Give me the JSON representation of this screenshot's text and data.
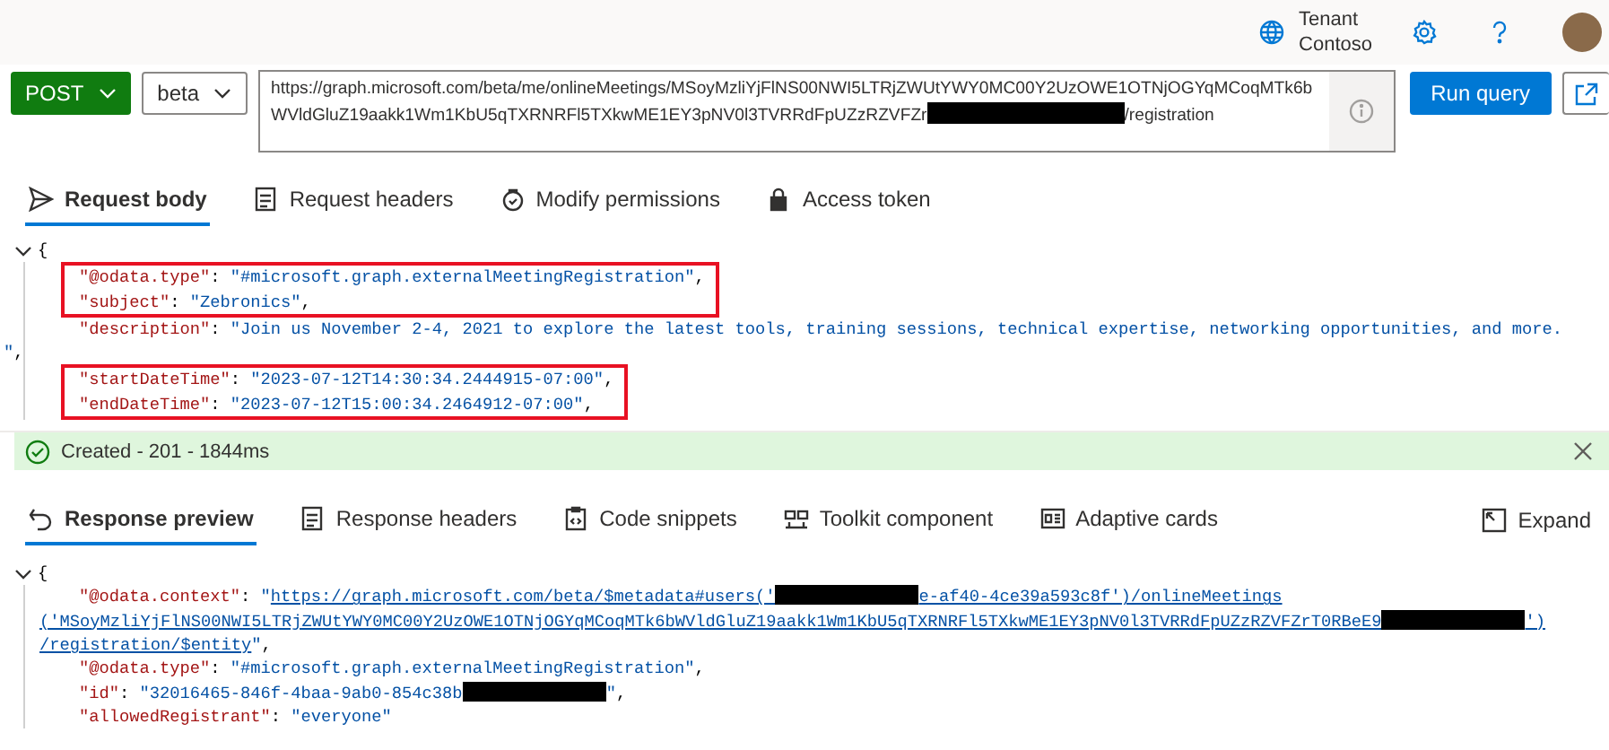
{
  "header": {
    "tenant_label": "Tenant",
    "tenant_name": "Contoso"
  },
  "query": {
    "method": "POST",
    "version": "beta",
    "url_parts": [
      {
        "kind": "text",
        "text": "https://graph.microsoft.com/beta/me/onlineMeetings/MSoyMzliYjFlNS00NWI5LTRjZWUtYWY0MC00Y2UzOWE1OTNjOGYqMCoqMTk6bWVldGluZ19aakk1Wm1KbU5qTXRNRFl5TXkwME1EY3pNV0l3TVRRdFpUZzRZVFZr"
      },
      {
        "kind": "redacted"
      },
      {
        "kind": "text",
        "text": "/registration"
      }
    ],
    "run_label": "Run query"
  },
  "request_tabs": [
    {
      "label": "Request body",
      "selected": true
    },
    {
      "label": "Request headers",
      "selected": false
    },
    {
      "label": "Modify permissions",
      "selected": false
    },
    {
      "label": "Access token",
      "selected": false
    }
  ],
  "request_body": {
    "expanded": true,
    "open": "{",
    "lines": [
      {
        "kind": "member",
        "highlighted": true,
        "parts": [
          {
            "kind": "key",
            "text": "\"@odata.type\""
          },
          {
            "kind": "punct",
            "text": ": "
          },
          {
            "kind": "string",
            "text": "\"#microsoft.graph.externalMeetingRegistration\""
          },
          {
            "kind": "punct",
            "text": ","
          }
        ]
      },
      {
        "kind": "member",
        "highlighted": true,
        "parts": [
          {
            "kind": "key",
            "text": "\"subject\""
          },
          {
            "kind": "punct",
            "text": ": "
          },
          {
            "kind": "string",
            "text": "\"Zebronics\""
          },
          {
            "kind": "punct",
            "text": ","
          }
        ]
      },
      {
        "kind": "member",
        "highlighted": false,
        "parts": [
          {
            "kind": "key",
            "text": "\"description\""
          },
          {
            "kind": "punct",
            "text": ": "
          },
          {
            "kind": "string",
            "text": "\"Join us November 2-4, 2021 to explore the latest tools, training sessions, technical expertise, networking opportunities, and more."
          }
        ]
      },
      {
        "kind": "wrap",
        "highlighted": false,
        "parts": [
          {
            "kind": "string",
            "text": "\""
          },
          {
            "kind": "punct",
            "text": ","
          }
        ]
      },
      {
        "kind": "member",
        "highlighted": true,
        "parts": [
          {
            "kind": "key",
            "text": "\"startDateTime\""
          },
          {
            "kind": "punct",
            "text": ": "
          },
          {
            "kind": "string",
            "text": "\"2023-07-12T14:30:34.2444915-07:00\""
          },
          {
            "kind": "punct",
            "text": ","
          }
        ]
      },
      {
        "kind": "member",
        "highlighted": true,
        "parts": [
          {
            "kind": "key",
            "text": "\"endDateTime\""
          },
          {
            "kind": "punct",
            "text": ": "
          },
          {
            "kind": "string",
            "text": "\"2023-07-12T15:00:34.2464912-07:00\""
          },
          {
            "kind": "punct",
            "text": ","
          }
        ]
      }
    ]
  },
  "status": {
    "kind": "success",
    "text": "Created - 201 - 1844ms"
  },
  "response_tabs": [
    {
      "label": "Response preview",
      "selected": true
    },
    {
      "label": "Response headers",
      "selected": false
    },
    {
      "label": "Code snippets",
      "selected": false
    },
    {
      "label": "Toolkit component",
      "selected": false
    },
    {
      "label": "Adaptive cards",
      "selected": false
    }
  ],
  "expand_label": "Expand",
  "response_body": {
    "expanded": true,
    "open": "{",
    "lines": [
      {
        "kind": "member",
        "highlighted": false,
        "parts": [
          {
            "kind": "key",
            "text": "\"@odata.context\""
          },
          {
            "kind": "punct",
            "text": ": "
          },
          {
            "kind": "string",
            "text": "\""
          },
          {
            "kind": "link",
            "text": "https://graph.microsoft.com/beta/$metadata#users('"
          },
          {
            "kind": "redacted"
          },
          {
            "kind": "link",
            "text": "e-af40-4ce39a593c8f')/onlineMeetings"
          }
        ]
      },
      {
        "kind": "wrap",
        "highlighted": false,
        "parts": [
          {
            "kind": "link",
            "text": "('MSoyMzliYjFlNS00NWI5LTRjZWUtYWY0MC00Y2UzOWE1OTNjOGYqMCoqMTk6bWVldGluZ19aakk1Wm1KbU5qTXRNRFl5TXkwME1EY3pNV0l3TVRRdFpUZzRZVFZrT0RBeE9"
          },
          {
            "kind": "redacted"
          },
          {
            "kind": "link",
            "text": "')"
          }
        ]
      },
      {
        "kind": "wrap",
        "highlighted": false,
        "parts": [
          {
            "kind": "link",
            "text": "/registration/$entity"
          },
          {
            "kind": "string",
            "text": "\""
          },
          {
            "kind": "punct",
            "text": ","
          }
        ]
      },
      {
        "kind": "member",
        "highlighted": false,
        "parts": [
          {
            "kind": "key",
            "text": "\"@odata.type\""
          },
          {
            "kind": "punct",
            "text": ": "
          },
          {
            "kind": "string",
            "text": "\"#microsoft.graph.externalMeetingRegistration\""
          },
          {
            "kind": "punct",
            "text": ","
          }
        ]
      },
      {
        "kind": "member",
        "highlighted": false,
        "parts": [
          {
            "kind": "key",
            "text": "\"id\""
          },
          {
            "kind": "punct",
            "text": ": "
          },
          {
            "kind": "string",
            "text": "\"32016465-846f-4baa-9ab0-854c38b"
          },
          {
            "kind": "redacted"
          },
          {
            "kind": "string",
            "text": "\""
          },
          {
            "kind": "punct",
            "text": ","
          }
        ]
      },
      {
        "kind": "member",
        "highlighted": false,
        "parts": [
          {
            "kind": "key",
            "text": "\"allowedRegistrant\""
          },
          {
            "kind": "punct",
            "text": ": "
          },
          {
            "kind": "string",
            "text": "\"everyone\""
          }
        ]
      }
    ]
  }
}
